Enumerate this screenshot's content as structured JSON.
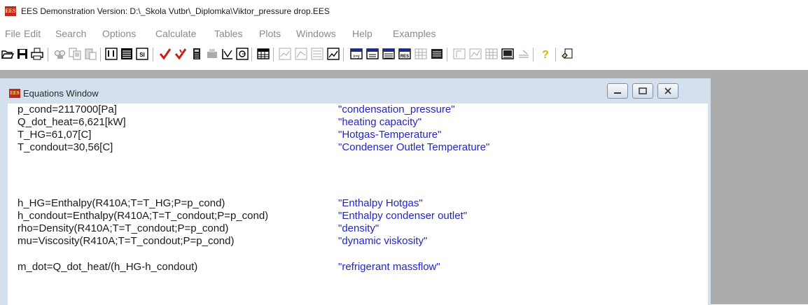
{
  "window": {
    "title": "EES Demonstration Version:  D:\\_Skola Vutbr\\_Diplomka\\Viktor_pressure drop.EES",
    "icon": "ees-app-icon",
    "icon_text": "EES"
  },
  "menu": [
    "File",
    "Edit",
    "Search",
    "Options",
    "Calculate",
    "Tables",
    "Plots",
    "Windows",
    "Help",
    "Examples"
  ],
  "toolbar": [
    "open-icon",
    "save-icon",
    "print-icon",
    "find-icon",
    "copy-icon",
    "paste-icon",
    "variable-info-icon",
    "solution-icon",
    "unit-system-icon",
    "check-icon",
    "check-units-icon",
    "calculator-icon",
    "printer-icon",
    "plot-icon",
    "gauge-icon",
    "table-icon",
    "plot-window-icon",
    "plot-window2-icon",
    "plot-window3-icon",
    "plot-window4-icon",
    "equations-window-icon",
    "formatted-equations-icon",
    "solution-window-icon",
    "residuals-icon",
    "parametric-table-icon",
    "lookup-table-icon",
    "diagram-icon",
    "chart-icon",
    "array-table-icon",
    "report-icon",
    "lines-icon",
    "help-icon",
    "hand-icon"
  ],
  "equations_window": {
    "title": "Equations Window",
    "icon": "ees-app-icon",
    "icon_text": "EES",
    "lines": [
      {
        "eq": "p_cond=2117000[Pa]",
        "comment": "\"condensation_pressure\""
      },
      {
        "eq": "Q_dot_heat=6,621[kW]",
        "comment": "\"heating capacity\""
      },
      {
        "eq": "T_HG=61,07[C]",
        "comment": "\"Hotgas-Temperature\""
      },
      {
        "eq": "T_condout=30,56[C]",
        "comment": "\"Condenser Outlet Temperature\""
      },
      {
        "eq": "h_HG=Enthalpy(R410A;T=T_HG;P=p_cond)",
        "comment": "\"Enthalpy Hotgas\""
      },
      {
        "eq": "h_condout=Enthalpy(R410A;T=T_condout;P=p_cond)",
        "comment": "\"Enthalpy condenser outlet\""
      },
      {
        "eq": "rho=Density(R410A;T=T_condout;P=p_cond)",
        "comment": "\"density\""
      },
      {
        "eq": "mu=Viscosity(R410A;T=T_condout;P=p_cond)",
        "comment": "\"dynamic viskosity\""
      },
      {
        "eq": "m_dot=Q_dot_heat/(h_HG-h_condout)",
        "comment": "\"refrigerant massflow\""
      }
    ]
  },
  "colors": {
    "equation_text": "#1a1a1a",
    "comment_text": "#2424c8",
    "window_frame": "#d4e0ee",
    "workspace": "#ababab"
  }
}
